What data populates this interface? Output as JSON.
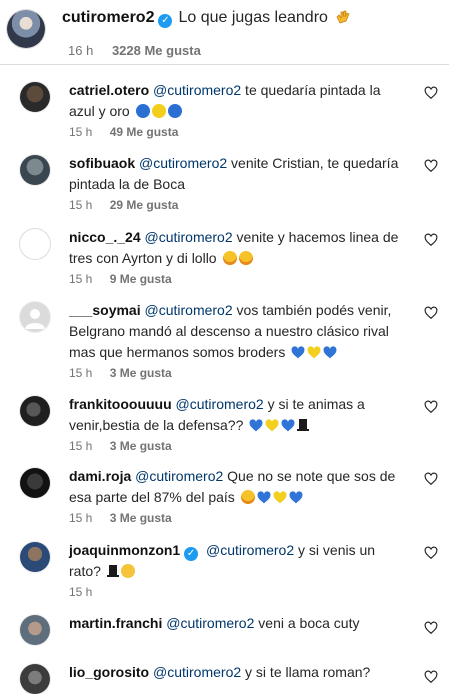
{
  "post": {
    "username": "cutiromero2",
    "caption": "Lo que jugas leandro",
    "time": "16 h",
    "likes": "3228 Me gusta"
  },
  "comments": [
    {
      "user": "catriel.otero",
      "mention": "@cutiromero2",
      "text": " te quedaría pintada la azul y oro",
      "time": "15 h",
      "likes": "49 Me gusta"
    },
    {
      "user": "sofibuaok",
      "mention": "@cutiromero2",
      "text": " venite Cristian, te quedaría pintada la de Boca",
      "time": "15 h",
      "likes": "29 Me gusta"
    },
    {
      "user": "nicco_._24",
      "mention": "@cutiromero2",
      "text": " venite y hacemos linea de tres con Ayrton y di lollo",
      "time": "15 h",
      "likes": "9 Me gusta"
    },
    {
      "user": "___soymai",
      "mention": "@cutiromero2",
      "text": " vos también podés venir, Belgrano mandó al descenso a nuestro clásico rival mas que hermanos somos broders",
      "time": "15 h",
      "likes": "3 Me gusta"
    },
    {
      "user": "frankitooouuuu",
      "mention": "@cutiromero2",
      "text": " y si te animas a venir,bestia de la defensa??",
      "time": "15 h",
      "likes": "3 Me gusta"
    },
    {
      "user": "dami.roja",
      "mention": "@cutiromero2",
      "text": " Que no se note que sos de esa parte del 87% del país",
      "time": "15 h",
      "likes": "3 Me gusta"
    },
    {
      "user": "joaquinmonzon1",
      "mention": "@cutiromero2",
      "text": " y si venis un rato?",
      "time": "15 h",
      "likes": ""
    },
    {
      "user": "martin.franchi",
      "mention": "@cutiromero2",
      "text": " veni a boca cuty",
      "time": "",
      "likes": ""
    },
    {
      "user": "lio_gorosito",
      "mention": "@cutiromero2",
      "text": " y si te llama roman?",
      "time": "",
      "likes": ""
    }
  ],
  "colors": {
    "accent": "#00376b",
    "verified": "#1d9bf0",
    "muted": "#737373"
  },
  "icons": [
    "verified-badge-icon",
    "clap-emoji-icon",
    "heart-outline-icon",
    "blue-circle-emoji",
    "yellow-circle-emoji",
    "blue-heart-emoji",
    "yellow-heart-emoji",
    "top-hat-emoji",
    "star-struck-emoji",
    "smile-emoji"
  ]
}
